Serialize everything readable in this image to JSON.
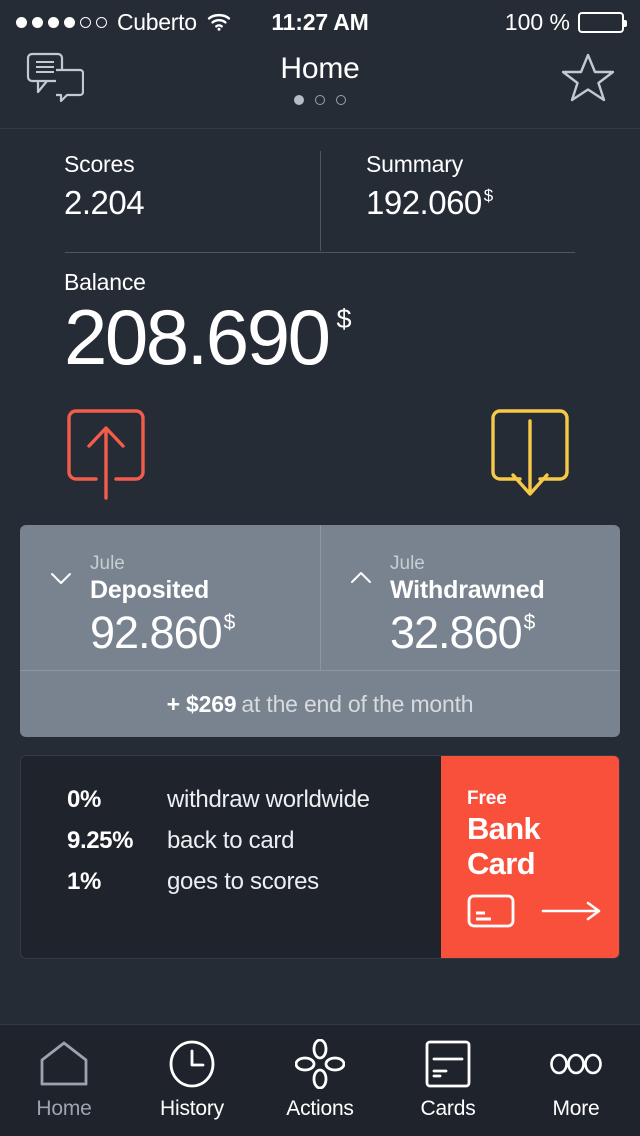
{
  "statusbar": {
    "carrier": "Cuberto",
    "signal_filled": 4,
    "signal_total": 6,
    "wifi_icon": "wifi-icon",
    "time": "11:27 AM",
    "battery_percent": "100 %",
    "battery_level": 100
  },
  "header": {
    "title": "Home",
    "left_icon": "messages-icon",
    "right_icon": "star-icon",
    "page_dots": 3,
    "active_dot": 0
  },
  "stats": [
    {
      "label": "Scores",
      "value": "2.204",
      "currency": ""
    },
    {
      "label": "Summary",
      "value": "192.060",
      "currency": "$"
    }
  ],
  "balance": {
    "label": "Balance",
    "value": "208.690",
    "currency": "$"
  },
  "actions": {
    "send": {
      "name": "send-money-button",
      "color": "#f25c4b"
    },
    "receive": {
      "name": "receive-money-button",
      "color": "#f7c948"
    }
  },
  "panel": {
    "columns": [
      {
        "month": "Jule",
        "title": "Deposited",
        "amount": "92.860",
        "currency": "$",
        "chevron": "chevron-down-icon"
      },
      {
        "month": "Jule",
        "title": "Withdrawned",
        "amount": "32.860",
        "currency": "$",
        "chevron": "chevron-up-icon"
      }
    ],
    "footer_amount": "+ $269",
    "footer_text": "at the end of the month",
    "background": "#79838f"
  },
  "promo": {
    "rows": [
      {
        "pct": "0%",
        "text": "withdraw worldwide"
      },
      {
        "pct": "9.25%",
        "text": "back to card"
      },
      {
        "pct": "1%",
        "text": "goes to scores"
      }
    ],
    "badge_small": "Free",
    "badge_line1": "Bank",
    "badge_line2": "Card",
    "badge_color": "#f9503c",
    "card_icon": "credit-card-icon",
    "arrow_icon": "arrow-right-icon"
  },
  "tabbar": [
    {
      "label": "Home",
      "icon": "house-icon",
      "active": false
    },
    {
      "label": "History",
      "icon": "clock-icon",
      "active": true
    },
    {
      "label": "Actions",
      "icon": "actions-icon",
      "active": true
    },
    {
      "label": "Cards",
      "icon": "card-icon",
      "active": true
    },
    {
      "label": "More",
      "icon": "more-dots-icon",
      "active": true
    }
  ]
}
